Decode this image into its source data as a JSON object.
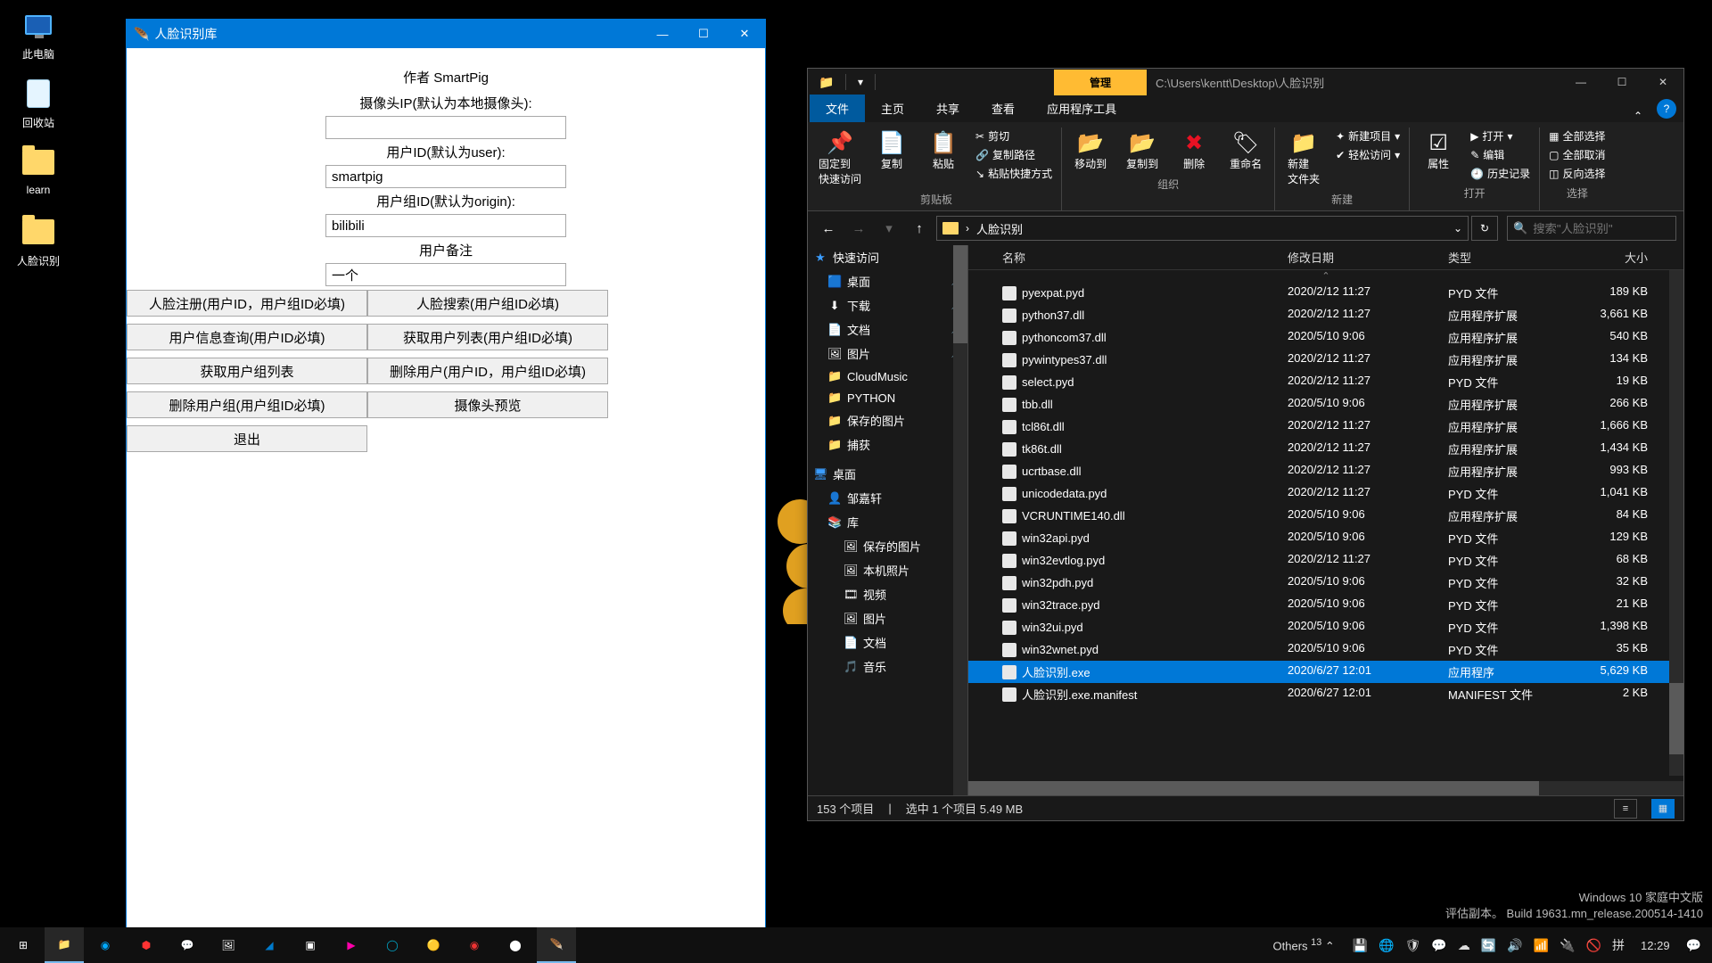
{
  "desktop": {
    "icons": [
      {
        "name": "pc",
        "label": "此电脑"
      },
      {
        "name": "bin",
        "label": "回收站"
      },
      {
        "name": "learn",
        "label": "learn"
      },
      {
        "name": "face",
        "label": "人脸识别"
      }
    ]
  },
  "tk": {
    "title": "人脸识别库",
    "author": "作者 SmartPig",
    "labels": {
      "camera": "摄像头IP(默认为本地摄像头):",
      "user": "用户ID(默认为user):",
      "group": "用户组ID(默认为origin):",
      "remark": "用户备注"
    },
    "values": {
      "camera": "",
      "user": "smartpig",
      "group": "bilibili",
      "remark": "一个"
    },
    "buttons": [
      "人脸注册(用户ID，用户组ID必填)",
      "人脸搜索(用户组ID必填)",
      "用户信息查询(用户ID必填)",
      "获取用户列表(用户组ID必填)",
      "获取用户组列表",
      "删除用户(用户ID，用户组ID必填)",
      "删除用户组(用户组ID必填)",
      "摄像头预览",
      "退出"
    ]
  },
  "explorer": {
    "titleTab": "管理",
    "path": "C:\\Users\\kentt\\Desktop\\人脸识别",
    "tabs": {
      "file": "文件",
      "home": "主页",
      "share": "共享",
      "view": "查看",
      "app": "应用程序工具"
    },
    "ribbon": {
      "clipboard": {
        "pin": "固定到\n快速访问",
        "copy": "复制",
        "paste": "粘贴",
        "cut": "剪切",
        "copypath": "复制路径",
        "shortcut": "粘贴快捷方式",
        "name": "剪贴板"
      },
      "organize": {
        "moveto": "移动到",
        "copyto": "复制到",
        "del": "删除",
        "rename": "重命名",
        "name": "组织"
      },
      "new": {
        "folder": "新建\n文件夹",
        "item": "新建项目",
        "easy": "轻松访问",
        "name": "新建"
      },
      "open": {
        "props": "属性",
        "open": "打开",
        "edit": "编辑",
        "history": "历史记录",
        "name": "打开"
      },
      "select": {
        "all": "全部选择",
        "none": "全部取消",
        "inv": "反向选择",
        "name": "选择"
      }
    },
    "breadcrumb": "人脸识别",
    "searchPlaceholder": "搜索\"人脸识别\"",
    "tree": {
      "quick": "快速访问",
      "quickItems": [
        {
          "label": "桌面",
          "icon": "🟦",
          "pin": true
        },
        {
          "label": "下载",
          "icon": "⬇",
          "pin": true
        },
        {
          "label": "文档",
          "icon": "📄",
          "pin": true
        },
        {
          "label": "图片",
          "icon": "🖼",
          "pin": true
        },
        {
          "label": "CloudMusic",
          "icon": "📁"
        },
        {
          "label": "PYTHON",
          "icon": "📁"
        },
        {
          "label": "保存的图片",
          "icon": "📁"
        },
        {
          "label": "捕获",
          "icon": "📁"
        }
      ],
      "desktop": "桌面",
      "user": "邹嘉轩",
      "lib": "库",
      "libItems": [
        {
          "label": "保存的图片",
          "icon": "🖼"
        },
        {
          "label": "本机照片",
          "icon": "🖼"
        },
        {
          "label": "视频",
          "icon": "🎞"
        },
        {
          "label": "图片",
          "icon": "🖼"
        },
        {
          "label": "文档",
          "icon": "📄"
        },
        {
          "label": "音乐",
          "icon": "🎵"
        }
      ]
    },
    "columns": {
      "name": "名称",
      "date": "修改日期",
      "type": "类型",
      "size": "大小"
    },
    "rows": [
      {
        "name": "pyexpat.pyd",
        "date": "2020/2/12 11:27",
        "type": "PYD 文件",
        "size": "189 KB"
      },
      {
        "name": "python37.dll",
        "date": "2020/2/12 11:27",
        "type": "应用程序扩展",
        "size": "3,661 KB"
      },
      {
        "name": "pythoncom37.dll",
        "date": "2020/5/10 9:06",
        "type": "应用程序扩展",
        "size": "540 KB"
      },
      {
        "name": "pywintypes37.dll",
        "date": "2020/2/12 11:27",
        "type": "应用程序扩展",
        "size": "134 KB"
      },
      {
        "name": "select.pyd",
        "date": "2020/2/12 11:27",
        "type": "PYD 文件",
        "size": "19 KB"
      },
      {
        "name": "tbb.dll",
        "date": "2020/5/10 9:06",
        "type": "应用程序扩展",
        "size": "266 KB"
      },
      {
        "name": "tcl86t.dll",
        "date": "2020/2/12 11:27",
        "type": "应用程序扩展",
        "size": "1,666 KB"
      },
      {
        "name": "tk86t.dll",
        "date": "2020/2/12 11:27",
        "type": "应用程序扩展",
        "size": "1,434 KB"
      },
      {
        "name": "ucrtbase.dll",
        "date": "2020/2/12 11:27",
        "type": "应用程序扩展",
        "size": "993 KB"
      },
      {
        "name": "unicodedata.pyd",
        "date": "2020/2/12 11:27",
        "type": "PYD 文件",
        "size": "1,041 KB"
      },
      {
        "name": "VCRUNTIME140.dll",
        "date": "2020/5/10 9:06",
        "type": "应用程序扩展",
        "size": "84 KB"
      },
      {
        "name": "win32api.pyd",
        "date": "2020/5/10 9:06",
        "type": "PYD 文件",
        "size": "129 KB"
      },
      {
        "name": "win32evtlog.pyd",
        "date": "2020/2/12 11:27",
        "type": "PYD 文件",
        "size": "68 KB"
      },
      {
        "name": "win32pdh.pyd",
        "date": "2020/5/10 9:06",
        "type": "PYD 文件",
        "size": "32 KB"
      },
      {
        "name": "win32trace.pyd",
        "date": "2020/5/10 9:06",
        "type": "PYD 文件",
        "size": "21 KB"
      },
      {
        "name": "win32ui.pyd",
        "date": "2020/5/10 9:06",
        "type": "PYD 文件",
        "size": "1,398 KB"
      },
      {
        "name": "win32wnet.pyd",
        "date": "2020/5/10 9:06",
        "type": "PYD 文件",
        "size": "35 KB"
      },
      {
        "name": "人脸识别.exe",
        "date": "2020/6/27 12:01",
        "type": "应用程序",
        "size": "5,629 KB",
        "sel": true
      },
      {
        "name": "人脸识别.exe.manifest",
        "date": "2020/6/27 12:01",
        "type": "MANIFEST 文件",
        "size": "2 KB"
      }
    ],
    "status": {
      "count": "153 个项目",
      "sel": "选中 1 个项目  5.49 MB"
    }
  },
  "watermark": {
    "l1": "Windows 10 家庭中文版",
    "l2": "评估副本。 Build 19631.mn_release.200514-1410"
  },
  "taskbar": {
    "others": "Others",
    "clock": "12:29"
  }
}
